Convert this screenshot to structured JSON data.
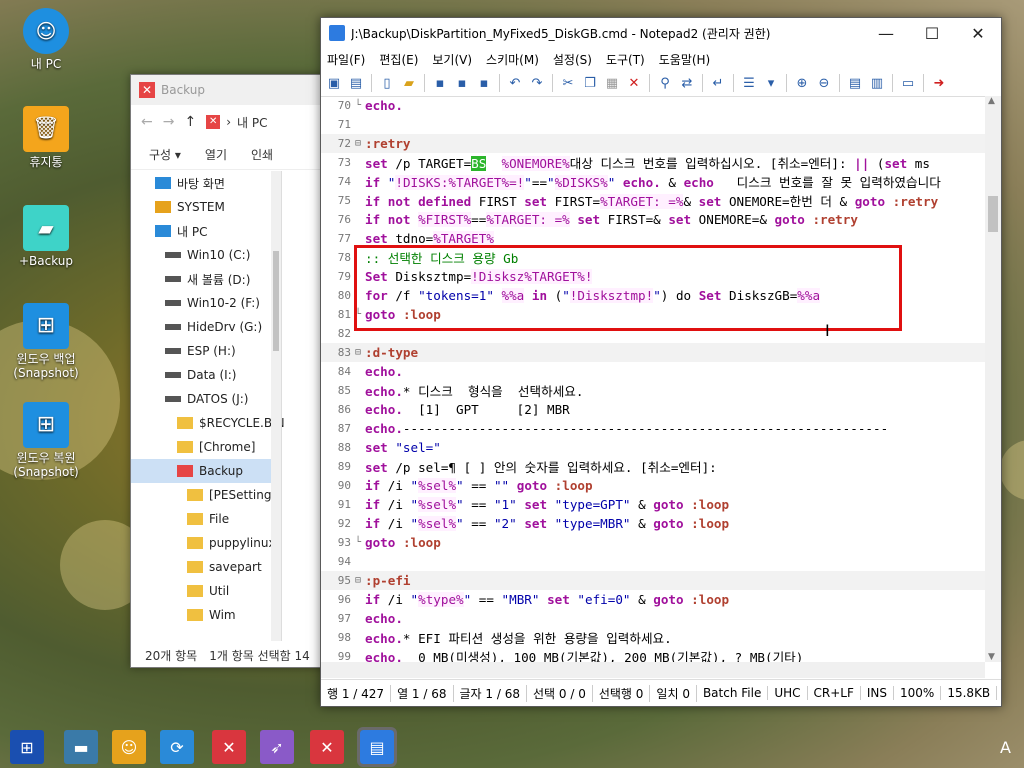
{
  "desktop": {
    "icons": [
      {
        "label": "내 PC",
        "icon": "my-pc-icon",
        "color": "#1e8fe0"
      },
      {
        "label": "휴지통",
        "icon": "recycle-bin-icon",
        "color": "#f4a51c"
      },
      {
        "label": "+Backup",
        "icon": "folder-icon",
        "color": "#3ed3c8"
      },
      {
        "label": "윈도우 백업\n(Snapshot)",
        "icon": "windows-icon",
        "color": "#1e8fe0"
      },
      {
        "label": "윈도우 복원\n(Snapshot)",
        "icon": "windows-icon",
        "color": "#1e8fe0"
      }
    ]
  },
  "explorer": {
    "title": "Backup",
    "nav_path": [
      "내 PC"
    ],
    "commands": [
      "구성 ▾",
      "열기",
      "인쇄"
    ],
    "tree": [
      {
        "label": "바탕 화면",
        "icon": "desktop-icon"
      },
      {
        "label": "SYSTEM",
        "icon": "user-icon"
      },
      {
        "label": "내 PC",
        "icon": "my-pc-icon"
      },
      {
        "label": "Win10 (C:)",
        "icon": "drive-icon"
      },
      {
        "label": "새 볼륨 (D:)",
        "icon": "drive-icon"
      },
      {
        "label": "Win10-2 (F:)",
        "icon": "drive-icon"
      },
      {
        "label": "HideDrv (G:)",
        "icon": "drive-icon"
      },
      {
        "label": "ESP (H:)",
        "icon": "drive-icon"
      },
      {
        "label": "Data (I:)",
        "icon": "drive-icon"
      },
      {
        "label": "DATOS (J:)",
        "icon": "drive-icon"
      },
      {
        "label": "$RECYCLE.BIN",
        "icon": "folder-icon"
      },
      {
        "label": "[Chrome]",
        "icon": "folder-icon"
      },
      {
        "label": "Backup",
        "icon": "backup-icon"
      },
      {
        "label": "[PESetting]",
        "icon": "folder-icon"
      },
      {
        "label": "File",
        "icon": "folder-icon"
      },
      {
        "label": "puppylinux",
        "icon": "folder-icon"
      },
      {
        "label": "savepart",
        "icon": "folder-icon"
      },
      {
        "label": "Util",
        "icon": "folder-icon"
      },
      {
        "label": "Wim",
        "icon": "folder-icon"
      }
    ],
    "status_count": "20개 항목",
    "status_selected": "1개 항목 선택함 14"
  },
  "notepad": {
    "title": "J:\\Backup\\DiskPartition_MyFixed5_DiskGB.cmd - Notepad2 (관리자 권한)",
    "menu": [
      "파일(F)",
      "편집(E)",
      "보기(V)",
      "스키마(M)",
      "설정(S)",
      "도구(T)",
      "도움말(H)"
    ],
    "status": [
      "행 1 / 427",
      "열 1 / 68",
      "글자 1 / 68",
      "선택 0 / 0",
      "선택행 0",
      "일치 0",
      "Batch File",
      "UHC",
      "CR+LF",
      "INS",
      "100%",
      "15.8KB"
    ]
  },
  "code_lines": [
    {
      "n": "70",
      "fold": "└",
      "html": "<span class=\"kw\">echo.</span>"
    },
    {
      "n": "71",
      "fold": "",
      "html": ""
    },
    {
      "n": "72",
      "fold": "⊟",
      "html": "<span class=\"lbl\">:retry</span>",
      "hl": true
    },
    {
      "n": "73",
      "fold": "",
      "html": "<span class=\"kw\">set</span> /p TARGET=<span style=\"background:#2bb52b;color:#fff\">BS</span>  <span class=\"var\">%ONEMORE%</span>대상 디스크 번호를 입력하십시오. [취소=엔터]: <span class=\"kw\">||</span> (<span class=\"kw\">set</span> ms"
    },
    {
      "n": "74",
      "fold": "",
      "html": "<span class=\"kw\">if</span> <span class=\"str\">\"</span><span class=\"var\">!DISKS:%TARGET%=!</span><span class=\"str\">\"</span>==<span class=\"str\">\"</span><span class=\"var\">%DISKS%</span><span class=\"str\">\"</span> <span class=\"kw\">echo.</span> & <span class=\"kw\">echo</span>   디스크 번호를 잘 못 입력하였습니다"
    },
    {
      "n": "75",
      "fold": "",
      "html": "<span class=\"kw\">if not defined</span> FIRST <span class=\"kw\">set</span> FIRST=<span class=\"var\">%TARGET: =%</span>& <span class=\"kw\">set</span> ONEMORE=한번 더 & <span class=\"kw\">goto</span> <span class=\"lbl\">:retry</span>"
    },
    {
      "n": "76",
      "fold": "",
      "html": "<span class=\"kw\">if not</span> <span class=\"var\">%FIRST%</span>==<span class=\"var\">%TARGET: =%</span> <span class=\"kw\">set</span> FIRST=& <span class=\"kw\">set</span> ONEMORE=& <span class=\"kw\">goto</span> <span class=\"lbl\">:retry</span>"
    },
    {
      "n": "77",
      "fold": "",
      "html": "<span class=\"kw\">set</span> tdno=<span class=\"var\">%TARGET%</span>"
    },
    {
      "n": "78",
      "fold": "",
      "html": "<span class=\"cmt\">:: 선택한 디스크 용량 Gb</span>"
    },
    {
      "n": "79",
      "fold": "",
      "html": "<span class=\"kw\">Set</span> Disksztmp=<span class=\"var\">!Disksz%TARGET%!</span>"
    },
    {
      "n": "80",
      "fold": "",
      "html": "<span class=\"kw\">for</span> /f <span class=\"str\">\"tokens=1\"</span> <span class=\"var\">%%a</span> <span class=\"kw\">in</span> (<span class=\"str\">\"</span><span class=\"var\">!Disksztmp!</span><span class=\"str\">\"</span>) do <span class=\"kw\">Set</span> DiskszGB=<span class=\"var\">%%a</span>"
    },
    {
      "n": "81",
      "fold": "└",
      "html": "<span class=\"kw\">goto</span> <span class=\"lbl\">:loop</span>"
    },
    {
      "n": "82",
      "fold": "",
      "html": ""
    },
    {
      "n": "83",
      "fold": "⊟",
      "html": "<span class=\"lbl\">:d-type</span>",
      "hl": true
    },
    {
      "n": "84",
      "fold": "",
      "html": "<span class=\"kw\">echo.</span>"
    },
    {
      "n": "85",
      "fold": "",
      "html": "<span class=\"kw\">echo.</span>* 디스크  형식을  선택하세요."
    },
    {
      "n": "86",
      "fold": "",
      "html": "<span class=\"kw\">echo.</span>  [1]  GPT     [2] MBR"
    },
    {
      "n": "87",
      "fold": "",
      "html": "<span class=\"kw\">echo.</span>----------------------------------------------------------------"
    },
    {
      "n": "88",
      "fold": "",
      "html": "<span class=\"kw\">set</span> <span class=\"str\">\"sel=\"</span>"
    },
    {
      "n": "89",
      "fold": "",
      "html": "<span class=\"kw\">set</span> /p sel=¶ [ ] 안의 숫자를 입력하세요. [취소=엔터]:"
    },
    {
      "n": "90",
      "fold": "",
      "html": "<span class=\"kw\">if</span> /i <span class=\"str\">\"</span><span class=\"var\">%sel%</span><span class=\"str\">\"</span> == <span class=\"str\">\"\"</span> <span class=\"kw\">goto</span> <span class=\"lbl\">:loop</span>"
    },
    {
      "n": "91",
      "fold": "",
      "html": "<span class=\"kw\">if</span> /i <span class=\"str\">\"</span><span class=\"var\">%sel%</span><span class=\"str\">\"</span> == <span class=\"str\">\"1\"</span> <span class=\"kw\">set</span> <span class=\"str\">\"type=GPT\"</span> & <span class=\"kw\">goto</span> <span class=\"lbl\">:loop</span>"
    },
    {
      "n": "92",
      "fold": "",
      "html": "<span class=\"kw\">if</span> /i <span class=\"str\">\"</span><span class=\"var\">%sel%</span><span class=\"str\">\"</span> == <span class=\"str\">\"2\"</span> <span class=\"kw\">set</span> <span class=\"str\">\"type=MBR\"</span> & <span class=\"kw\">goto</span> <span class=\"lbl\">:loop</span>"
    },
    {
      "n": "93",
      "fold": "└",
      "html": "<span class=\"kw\">goto</span> <span class=\"lbl\">:loop</span>"
    },
    {
      "n": "94",
      "fold": "",
      "html": ""
    },
    {
      "n": "95",
      "fold": "⊟",
      "html": "<span class=\"lbl\">:p-efi</span>",
      "hl": true
    },
    {
      "n": "96",
      "fold": "",
      "html": "<span class=\"kw\">if</span> /i <span class=\"str\">\"</span><span class=\"var\">%type%</span><span class=\"str\">\"</span> == <span class=\"str\">\"MBR\"</span> <span class=\"kw\">set</span> <span class=\"str\">\"efi=0\"</span> & <span class=\"kw\">goto</span> <span class=\"lbl\">:loop</span>"
    },
    {
      "n": "97",
      "fold": "",
      "html": "<span class=\"kw\">echo.</span>"
    },
    {
      "n": "98",
      "fold": "",
      "html": "<span class=\"kw\">echo.</span>* EFI 파티션 생성을 위한 용량을 입력하세요."
    },
    {
      "n": "99",
      "fold": "",
      "html": "<span class=\"kw\">echo.</span>  0 MB(미생성), 100 MB(기본값), 200 MB(기본값), ? MB(기타)"
    }
  ],
  "taskbar": {
    "items": [
      {
        "icon": "start-icon",
        "color": "#1a4fb0"
      },
      {
        "icon": "drive-manager-icon",
        "color": "#3a7aa8"
      },
      {
        "icon": "user-search-icon",
        "color": "#e6a21c"
      },
      {
        "icon": "sync-icon",
        "color": "#2a8ad8"
      },
      {
        "icon": "x-tool-icon",
        "color": "#d9363e"
      },
      {
        "icon": "rocket-icon",
        "color": "#8a5ac8"
      },
      {
        "icon": "backup-app-icon",
        "color": "#d9363e"
      },
      {
        "icon": "notepad-icon",
        "color": "#2d7be0"
      }
    ],
    "ime": "A"
  }
}
